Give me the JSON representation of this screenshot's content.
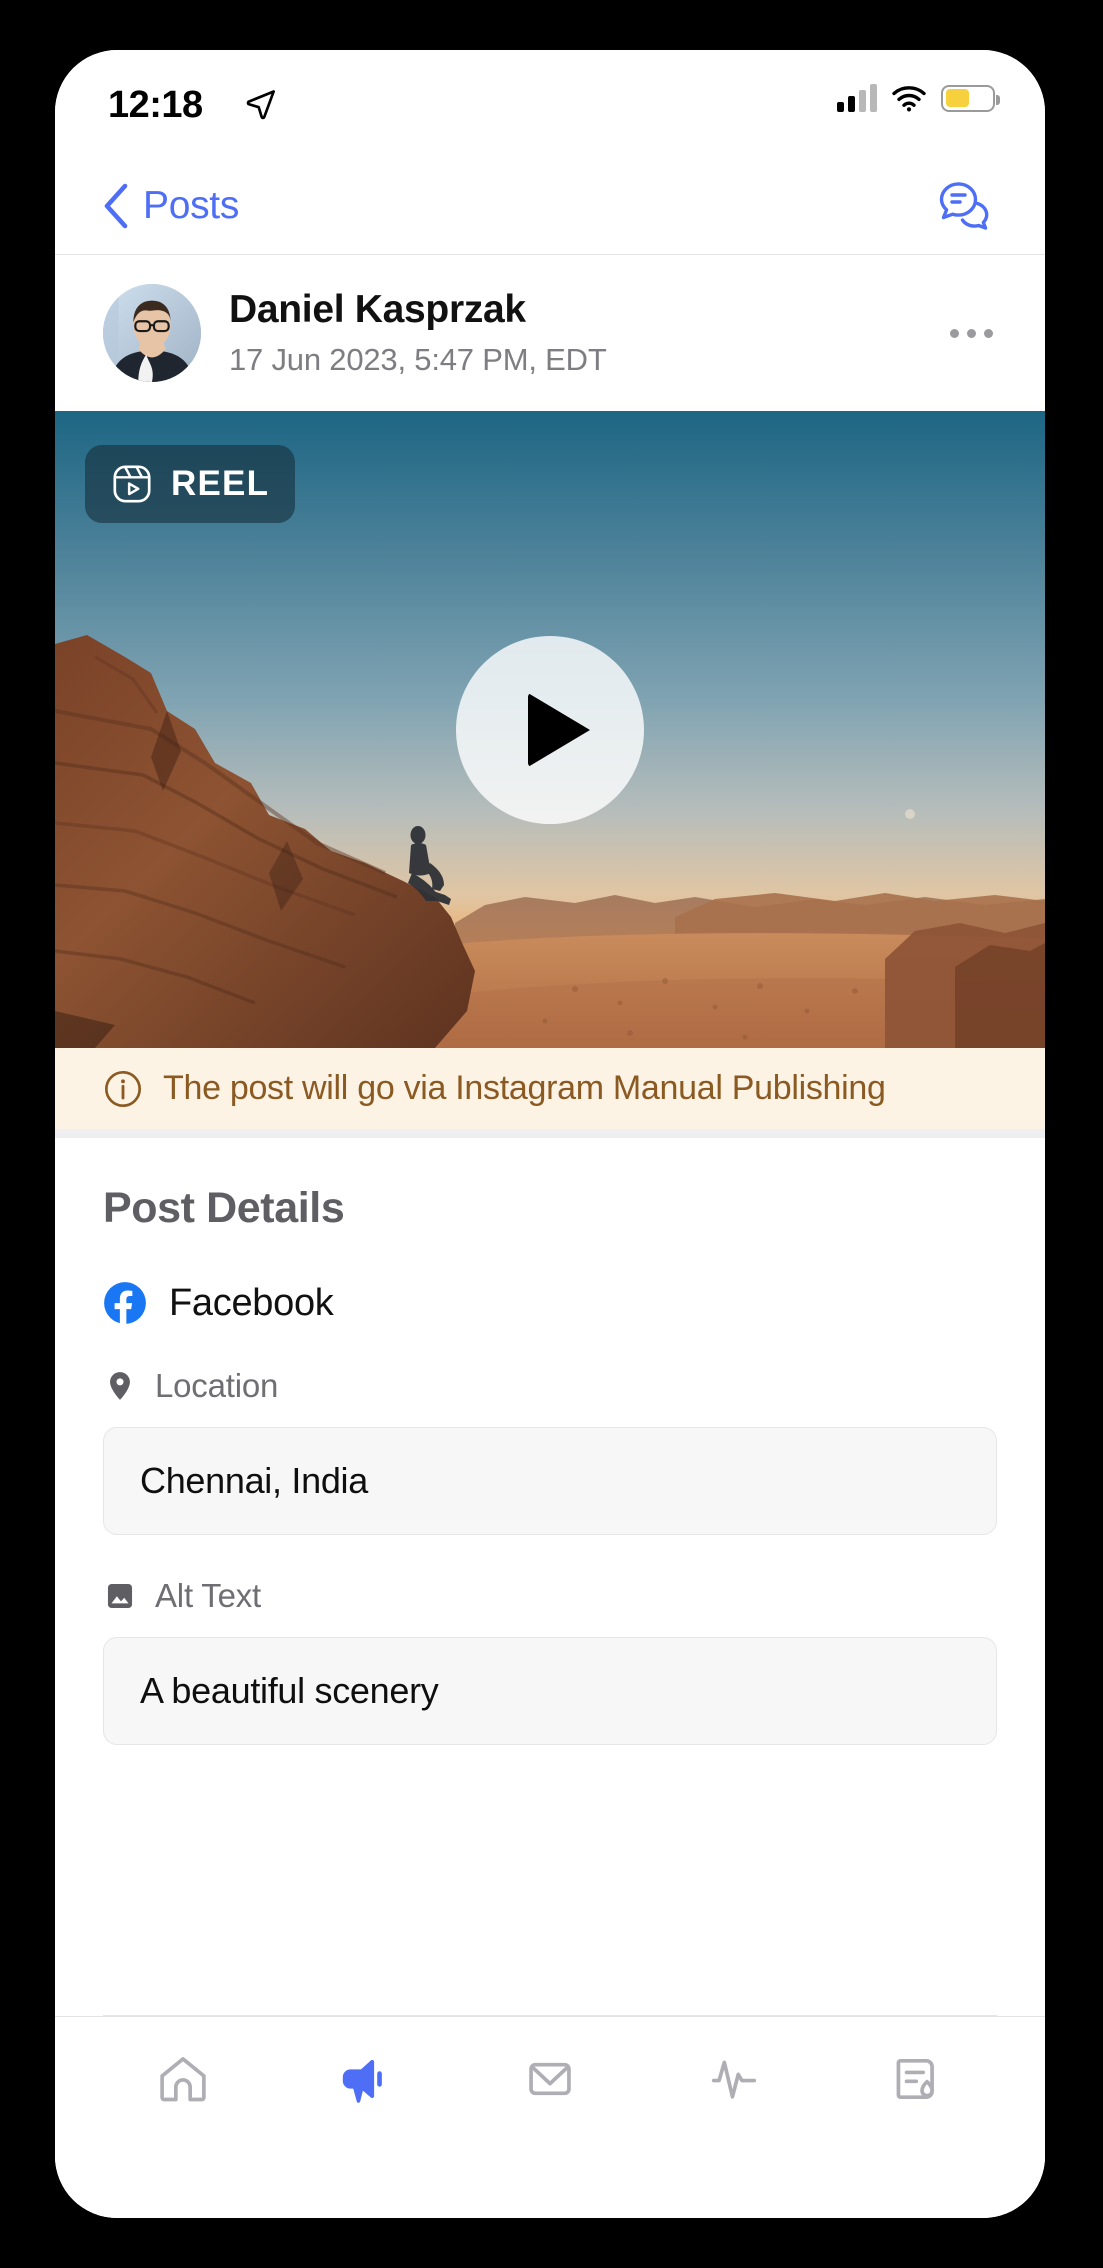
{
  "status_bar": {
    "time": "12:18",
    "location_icon": "location-arrow-icon",
    "signal_icon": "cellular-signal-icon",
    "wifi_icon": "wifi-icon",
    "battery_icon": "battery-low-power-icon",
    "battery_color": "#f7d13d"
  },
  "nav": {
    "back_icon": "chevron-left-icon",
    "back_label": "Posts",
    "comments_icon": "comments-bubbles-icon",
    "accent_color": "#4d6ef5"
  },
  "post": {
    "author_name": "Daniel Kasprzak",
    "timestamp": "17 Jun 2023, 5:47 PM, EDT",
    "avatar_icon": "user-avatar-photo",
    "more_icon": "more-horizontal-icon"
  },
  "media": {
    "badge_label": "REEL",
    "badge_icon": "instagram-reel-icon",
    "play_icon": "play-icon",
    "alt_description": "Person sitting on a desert cliff at sunset"
  },
  "banner": {
    "icon": "info-circle-icon",
    "text": "The post will go via Instagram Manual Publishing",
    "text_color": "#8a5a22",
    "background_color": "#fdf3e4"
  },
  "details": {
    "title": "Post Details",
    "channel": {
      "icon": "facebook-icon",
      "name": "Facebook",
      "brand_color": "#1977f3"
    },
    "fields": [
      {
        "icon": "location-pin-icon",
        "label": "Location",
        "value": "Chennai, India"
      },
      {
        "icon": "image-icon",
        "label": "Alt Text",
        "value": "A beautiful scenery"
      }
    ]
  },
  "tab_bar": {
    "active_color": "#4d6ef5",
    "inactive_color": "#aeaeb4",
    "items": [
      {
        "icon": "home-icon",
        "active": false
      },
      {
        "icon": "megaphone-icon",
        "active": true
      },
      {
        "icon": "envelope-icon",
        "active": false
      },
      {
        "icon": "activity-pulse-icon",
        "active": false
      },
      {
        "icon": "report-rocket-icon",
        "active": false
      }
    ]
  }
}
